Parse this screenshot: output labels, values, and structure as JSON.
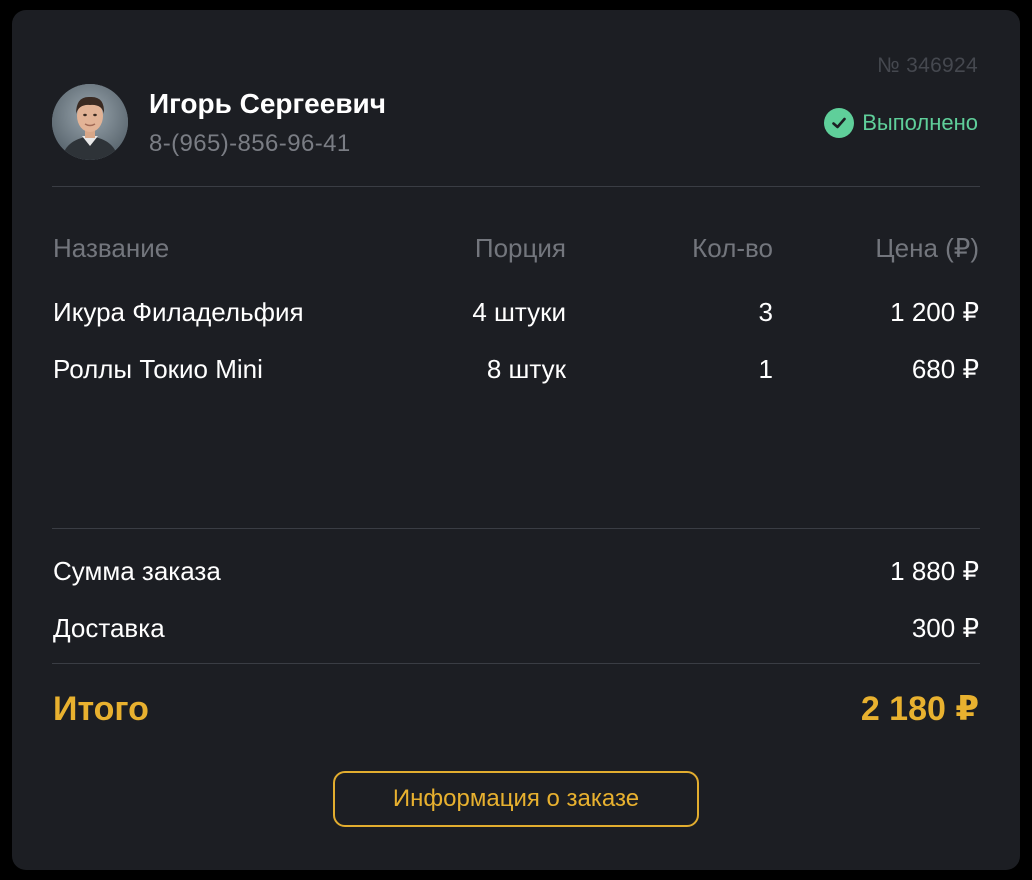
{
  "order": {
    "number": "№ 346924",
    "status_label": "Выполнено",
    "status_icon": "check-circle-icon",
    "status_color": "#5fcf9a"
  },
  "customer": {
    "name": "Игорь Сергеевич",
    "phone": "8-(965)-856-96-41"
  },
  "table": {
    "columns": [
      "Название",
      "Порция",
      "Кол-во",
      "Цена (₽)"
    ],
    "rows": [
      {
        "name": "Икура Филадельфия",
        "portion": "4 штуки",
        "qty": "3",
        "price": "1 200 ₽"
      },
      {
        "name": "Роллы Токио Mini",
        "portion": "8 штук",
        "qty": "1",
        "price": "680 ₽"
      }
    ]
  },
  "summary": {
    "subtotal_label": "Сумма заказа",
    "subtotal_value": "1 880 ₽",
    "delivery_label": "Доставка",
    "delivery_value": "300 ₽",
    "total_label": "Итого",
    "total_value": "2 180 ₽"
  },
  "actions": {
    "info_button_label": "Информация о заказе"
  },
  "colors": {
    "accent": "#e8b12f",
    "background": "#1c1e23",
    "success": "#5fcf9a"
  }
}
